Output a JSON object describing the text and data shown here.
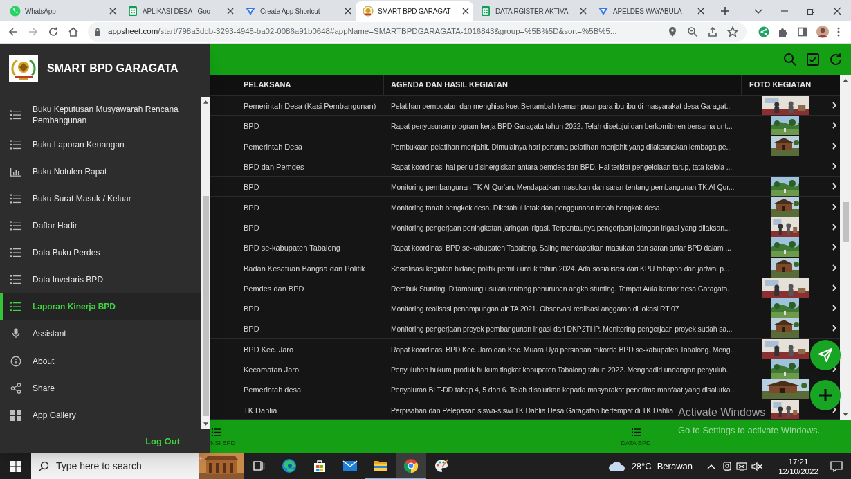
{
  "browser": {
    "tabs": [
      {
        "kind": "chat",
        "label": "WhatsApp",
        "selected": false
      },
      {
        "kind": "sheet",
        "label": "APLIKASI DESA - Goo",
        "selected": false
      },
      {
        "kind": "form",
        "label": "Create App Shortcut -",
        "selected": false
      },
      {
        "kind": "app",
        "label": "SMART BPD GARAGAT",
        "selected": true
      },
      {
        "kind": "sheet",
        "label": "DATA RGISTER AKTIVA",
        "selected": false
      },
      {
        "kind": "form",
        "label": "APELDES WAYABULA -",
        "selected": false
      }
    ],
    "url": {
      "host": "appsheet.com",
      "path": "/start/798a3ddb-3293-4945-ba02-0086a91b0648#appName=SMARTBPDGARAGATA-1016843&group=%5B%5D&sort=%5B%5..."
    }
  },
  "sidebar": {
    "title": "SMART BPD GARAGATA",
    "items": [
      {
        "kind": "list",
        "label": "Buku Keputusan Musyawarah Rencana Pembangunan",
        "selected": false
      },
      {
        "kind": "list",
        "label": "Buku Laporan Keuangan",
        "selected": false
      },
      {
        "kind": "chart",
        "label": "Buku Notulen Rapat",
        "selected": false
      },
      {
        "kind": "list",
        "label": "Buku Surat Masuk / Keluar",
        "selected": false
      },
      {
        "kind": "list",
        "label": "Daftar Hadir",
        "selected": false
      },
      {
        "kind": "list",
        "label": "Data Buku Perdes",
        "selected": false
      },
      {
        "kind": "list",
        "label": "Data Invetaris BPD",
        "selected": false
      },
      {
        "kind": "list",
        "label": "Laporan Kinerja BPD",
        "selected": true
      },
      {
        "kind": "mic",
        "label": "Assistant",
        "selected": false
      }
    ],
    "links": [
      {
        "kind": "info",
        "label": "About"
      },
      {
        "kind": "share",
        "label": "Share"
      },
      {
        "kind": "grid",
        "label": "App Gallery"
      }
    ],
    "logout": "Log Out"
  },
  "table": {
    "columns": [
      "PELAKSANA",
      "AGENDA DAN HASIL KEGIATAN",
      "FOTO KEGIATAN"
    ],
    "rows": [
      {
        "kind": "wide-photo",
        "pelaksana": "Pemerintah Desa (Kasi Pembangunan)",
        "agenda": "Pelatihan pembuatan dan menghias kue. Bertambah kemampuan para ibu-ibu di masyarakat desa Garagat..."
      },
      {
        "kind": "narrow-photo",
        "pelaksana": "BPD",
        "agenda": "Rapat penyusunan program kerja BPD Garagata tahun 2022. Telah disetujui dan berkomitmen bersama unt..."
      },
      {
        "kind": "narrow-photo",
        "pelaksana": "Pemerintah Desa",
        "agenda": "Pembukaan pelatihan menjahit. Dimulainya hari pertama pelatihan menjahit yang dilaksanakan lembaga pe..."
      },
      {
        "kind": "text-only",
        "pelaksana": "BPD dan Pemdes",
        "agenda": "Rapat koordinasi hal perlu disinergiskan antara pemdes dan BPD. Hal terkiat pengelolaan tarup, tata kelola ..."
      },
      {
        "kind": "narrow-photo",
        "pelaksana": "BPD",
        "agenda": "Monitoring pembangunan TK Al-Qur'an. Mendapatkan masukan dan saran tentang pembangunan TK Al-Qur..."
      },
      {
        "kind": "narrow-photo",
        "pelaksana": "BPD",
        "agenda": "Monitoring tanah bengkok desa. Diketahui letak dan penggunaan tanah bengkok desa."
      },
      {
        "kind": "narrow-photo",
        "pelaksana": "BPD",
        "agenda": "Monitoring pengerjaan peningkatan jaringan irigasi. Terpantaunya pengerjaan jaringan irigasi yang dilaksan..."
      },
      {
        "kind": "narrow-photo",
        "pelaksana": "BPD se-kabupaten Tabalong",
        "agenda": "Rapat koordinasi BPD se-kabupaten Tabalong. Saling mendapatkan masukan dan saran antar BPD dalam ..."
      },
      {
        "kind": "narrow-photo",
        "pelaksana": "Badan Kesatuan Bangsa dan Politik",
        "agenda": "Sosialisasi kegiatan bidang politik pemilu untuk tahun 2024. Ada sosialisasi dari KPU tahapan dan jadwal p..."
      },
      {
        "kind": "wide-photo",
        "pelaksana": "Pemdes dan BPD",
        "agenda": "Rembuk Stunting. Ditambung usulan tentang penurunan angka stunting. Tempat Aula kantor desa Garagata."
      },
      {
        "kind": "narrow-photo",
        "pelaksana": "BPD",
        "agenda": "Monitoring realisasi penampungan air TA 2021. Observasi realisasi anggaran di lokasi RT 07"
      },
      {
        "kind": "narrow-photo",
        "pelaksana": "BPD",
        "agenda": "Monitoring pengerjaan proyek pembangunan irigasi dari DKP2THP. Monitoring pengerjaan proyek sudah sa..."
      },
      {
        "kind": "wide-photo",
        "pelaksana": "BPD Kec. Jaro",
        "agenda": "Rapat koordinasi BPD Kec. Jaro dan Kec. Muara Uya persiapan rakorda BPD se-kabupaten Tabalong. Meng..."
      },
      {
        "kind": "narrow-photo",
        "pelaksana": "Kecamatan Jaro",
        "agenda": "Penyuluhan hukum produk hukum tingkat kabupaten Tabalong tahun 2022. Menghadiri undangan penyuluh..."
      },
      {
        "kind": "wide-photo",
        "pelaksana": "Pemerintah desa",
        "agenda": "Penyaluran BLT-DD tahap 4, 5 dan 6. Telah disalurkan kepada masyarakat penerima manfaat yang disalurka..."
      },
      {
        "kind": "narrow-photo",
        "pelaksana": "TK Dahlia",
        "agenda": "Perpisahan dan Pelepasan siswa-siswi TK Dahlia Desa Garagatan bertempat di TK Dahlia"
      }
    ]
  },
  "bottom_nav": [
    {
      "label": "NSI BPD"
    },
    {
      "label": "DATA BPD"
    }
  ],
  "activation_notice": {
    "title": "Activate Windows",
    "subtitle": "Go to Settings to activate Windows."
  },
  "taskbar": {
    "search_placeholder": "Type here to search",
    "apps": [
      {
        "kind": "taskview",
        "open": false,
        "active": false
      },
      {
        "kind": "edge",
        "open": false,
        "active": false
      },
      {
        "kind": "store",
        "open": false,
        "active": false
      },
      {
        "kind": "mail",
        "open": false,
        "active": false
      },
      {
        "kind": "explorer",
        "open": true,
        "active": false
      },
      {
        "kind": "chrome",
        "open": true,
        "active": true
      },
      {
        "kind": "paint",
        "open": false,
        "active": false
      }
    ],
    "weather": {
      "temperature": "28°C",
      "condition": "Berawan"
    },
    "time": "17:21",
    "date": "12/10/2022"
  }
}
